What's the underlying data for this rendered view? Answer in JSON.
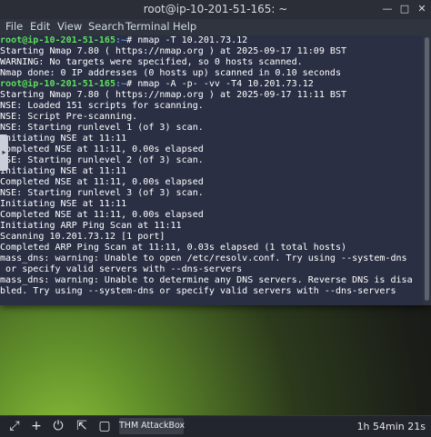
{
  "window": {
    "title": "root@ip-10-201-51-165: ~"
  },
  "menu": {
    "items": [
      "File",
      "Edit",
      "View",
      "Search",
      "Terminal",
      "Help"
    ]
  },
  "terminal": {
    "lines": [
      {
        "user": "root@ip-10-201-51-165",
        "path": ":~",
        "text": "# nmap -T 10.201.73.12"
      },
      {
        "text": "Starting Nmap 7.80 ( https://nmap.org ) at 2025-09-17 11:09 BST"
      },
      {
        "text": "WARNING: No targets were specified, so 0 hosts scanned."
      },
      {
        "text": "Nmap done: 0 IP addresses (0 hosts up) scanned in 0.10 seconds"
      },
      {
        "user": "root@ip-10-201-51-165",
        "path": ":~",
        "text": "# nmap -A -p- -vv -T4 10.201.73.12"
      },
      {
        "text": "Starting Nmap 7.80 ( https://nmap.org ) at 2025-09-17 11:11 BST"
      },
      {
        "text": "NSE: Loaded 151 scripts for scanning."
      },
      {
        "text": "NSE: Script Pre-scanning."
      },
      {
        "text": "NSE: Starting runlevel 1 (of 3) scan."
      },
      {
        "text": "Initiating NSE at 11:11"
      },
      {
        "text": "Completed NSE at 11:11, 0.00s elapsed"
      },
      {
        "text": "NSE: Starting runlevel 2 (of 3) scan."
      },
      {
        "text": "Initiating NSE at 11:11"
      },
      {
        "text": "Completed NSE at 11:11, 0.00s elapsed"
      },
      {
        "text": "NSE: Starting runlevel 3 (of 3) scan."
      },
      {
        "text": "Initiating NSE at 11:11"
      },
      {
        "text": "Completed NSE at 11:11, 0.00s elapsed"
      },
      {
        "text": "Initiating ARP Ping Scan at 11:11"
      },
      {
        "text": "Scanning 10.201.73.12 [1 port]"
      },
      {
        "text": "Completed ARP Ping Scan at 11:11, 0.03s elapsed (1 total hosts)"
      },
      {
        "text": "mass_dns: warning: Unable to open /etc/resolv.conf. Try using --system-dns"
      },
      {
        "text": " or specify valid servers with --dns-servers"
      },
      {
        "text": "mass_dns: warning: Unable to determine any DNS servers. Reverse DNS is disa"
      },
      {
        "text": "bled. Try using --system-dns or specify valid servers with --dns-servers"
      }
    ]
  },
  "taskbar": {
    "task_label": "THM AttackBox",
    "clock": "1h 54min 21s"
  },
  "colors": {
    "terminal_bg": "#2b2f44",
    "prompt_user": "#5ce05c",
    "prompt_path": "#5e97e0",
    "text": "#ffffff"
  }
}
